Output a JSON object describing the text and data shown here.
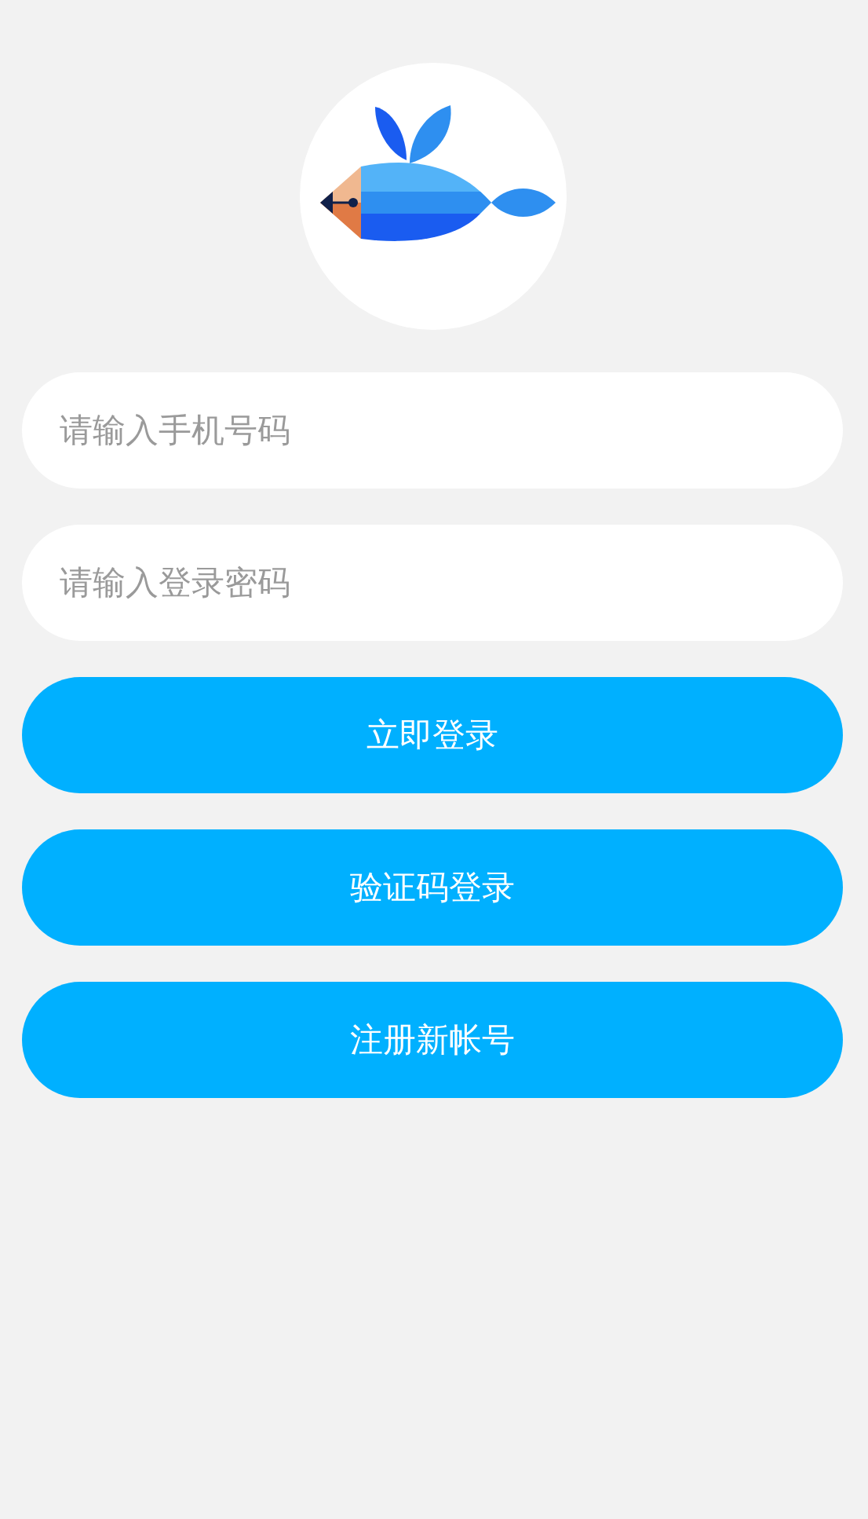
{
  "fields": [
    {
      "placeholder": "请输入手机号码"
    },
    {
      "placeholder": "请输入登录密码"
    }
  ],
  "buttons": [
    {
      "label": "立即登录"
    },
    {
      "label": "验证码登录"
    },
    {
      "label": "注册新帐号"
    }
  ]
}
